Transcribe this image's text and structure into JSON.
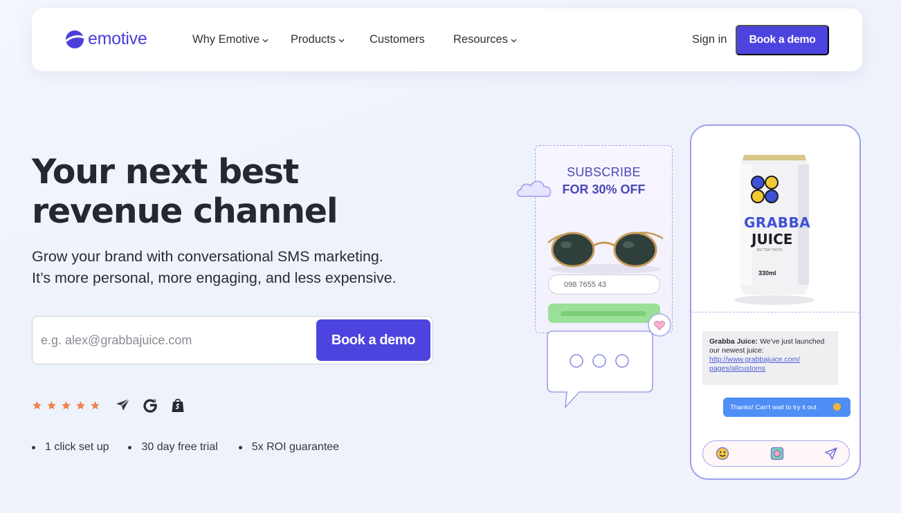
{
  "brand": {
    "name": "emotive",
    "color": "#4b3fdc"
  },
  "nav": {
    "links": [
      {
        "label": "Why Emotive",
        "has_dropdown": true
      },
      {
        "label": "Products",
        "has_dropdown": true
      },
      {
        "label": "Customers",
        "has_dropdown": false
      },
      {
        "label": "Resources",
        "has_dropdown": true
      }
    ],
    "sign_in": "Sign in",
    "cta": "Book a demo"
  },
  "hero": {
    "title_line1": "Your next best",
    "title_line2": "revenue channel",
    "subtitle_line1": "Grow your brand with conversational SMS marketing.",
    "subtitle_line2": "It’s more personal, more engaging, and less expensive.",
    "email_placeholder": "e.g. alex@grabbajuice.com",
    "email_value": "",
    "cta": "Book a demo",
    "rating_stars": 5,
    "badges": [
      "paper-plane-icon",
      "g2-icon",
      "shopify-icon"
    ],
    "perks": [
      "1 click set up",
      "30 day free trial",
      "5x ROI guarantee"
    ]
  },
  "illustration": {
    "popup": {
      "line1": "SUBSCRIBE",
      "line2": "FOR 30% OFF",
      "phone_value": "098 7655 43"
    },
    "product": {
      "brand_line1": "GRABBA",
      "brand_line2": "JUICE",
      "tagline": "BETTER TASTE",
      "volume": "330ml"
    },
    "chat": {
      "sender": "Grabba Juice:",
      "message": " We've just launched our newest juice:",
      "link_line1": "http://www.grabbajuice.com/",
      "link_line2": "pages/allcustoms",
      "reply": "Thanks! Can't wait to try it out"
    }
  },
  "colors": {
    "accent": "#4d44e0",
    "star": "#f0824a",
    "success": "#9be099",
    "chat_reply": "#4f8ef5"
  }
}
